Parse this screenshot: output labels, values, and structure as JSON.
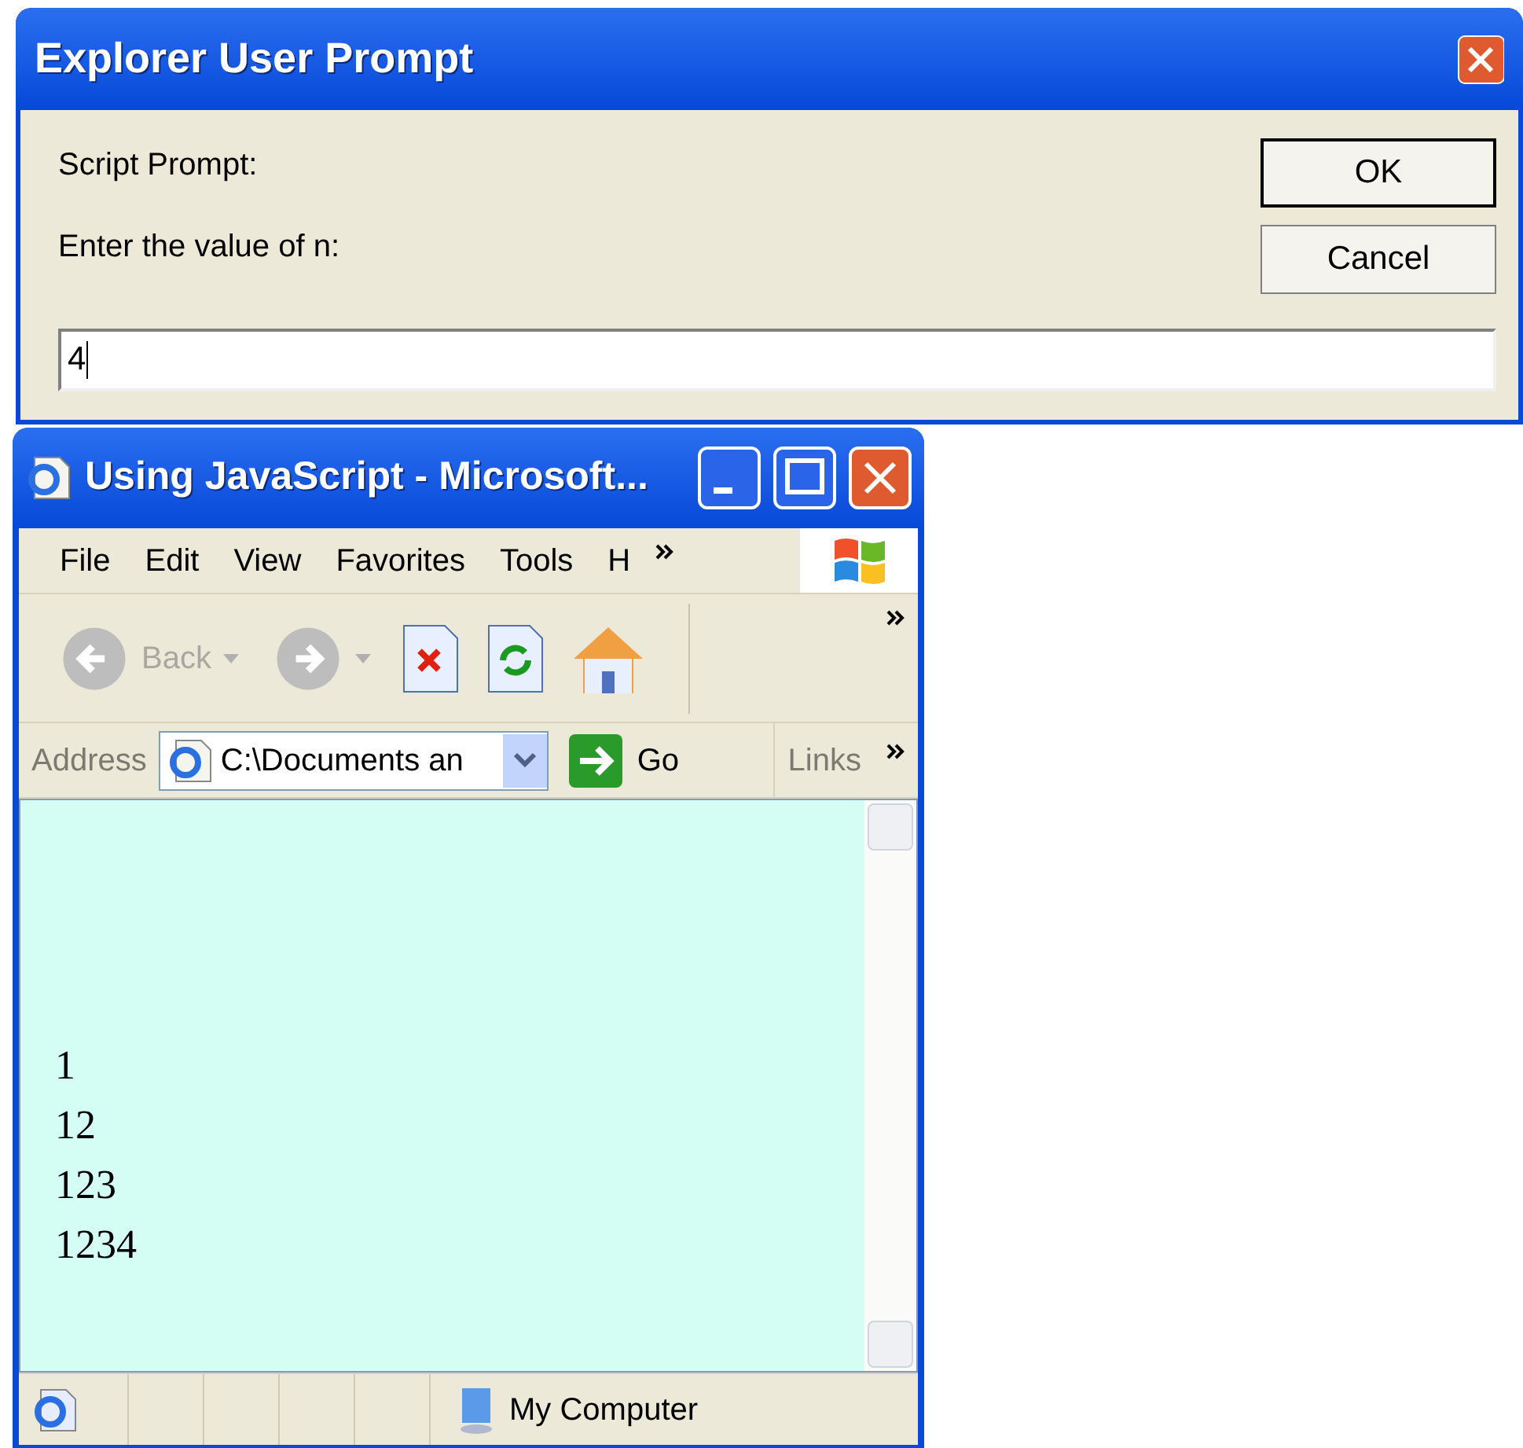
{
  "dialog": {
    "title": "Explorer User Prompt",
    "label": "Script Prompt:",
    "message": "Enter the value of n:",
    "value": "4",
    "buttons": [
      {
        "label": "OK",
        "default": true
      },
      {
        "label": "Cancel",
        "default": false
      }
    ]
  },
  "browser": {
    "title": "Using JavaScript - Microsoft...",
    "menu": [
      "File",
      "Edit",
      "View",
      "Favorites",
      "Tools",
      "H"
    ],
    "toolbar": [
      {
        "kind": "back",
        "label": "Back",
        "disabled": true
      },
      {
        "kind": "forward",
        "disabled": true
      },
      {
        "kind": "stop",
        "disabled": false
      },
      {
        "kind": "refresh",
        "disabled": false
      },
      {
        "kind": "home",
        "disabled": false
      }
    ],
    "address": {
      "label": "Address",
      "value": "C:\\Documents an",
      "go": "Go",
      "links": "Links"
    },
    "content": [
      "1",
      "12",
      "123",
      "1234"
    ],
    "status": "My Computer"
  }
}
